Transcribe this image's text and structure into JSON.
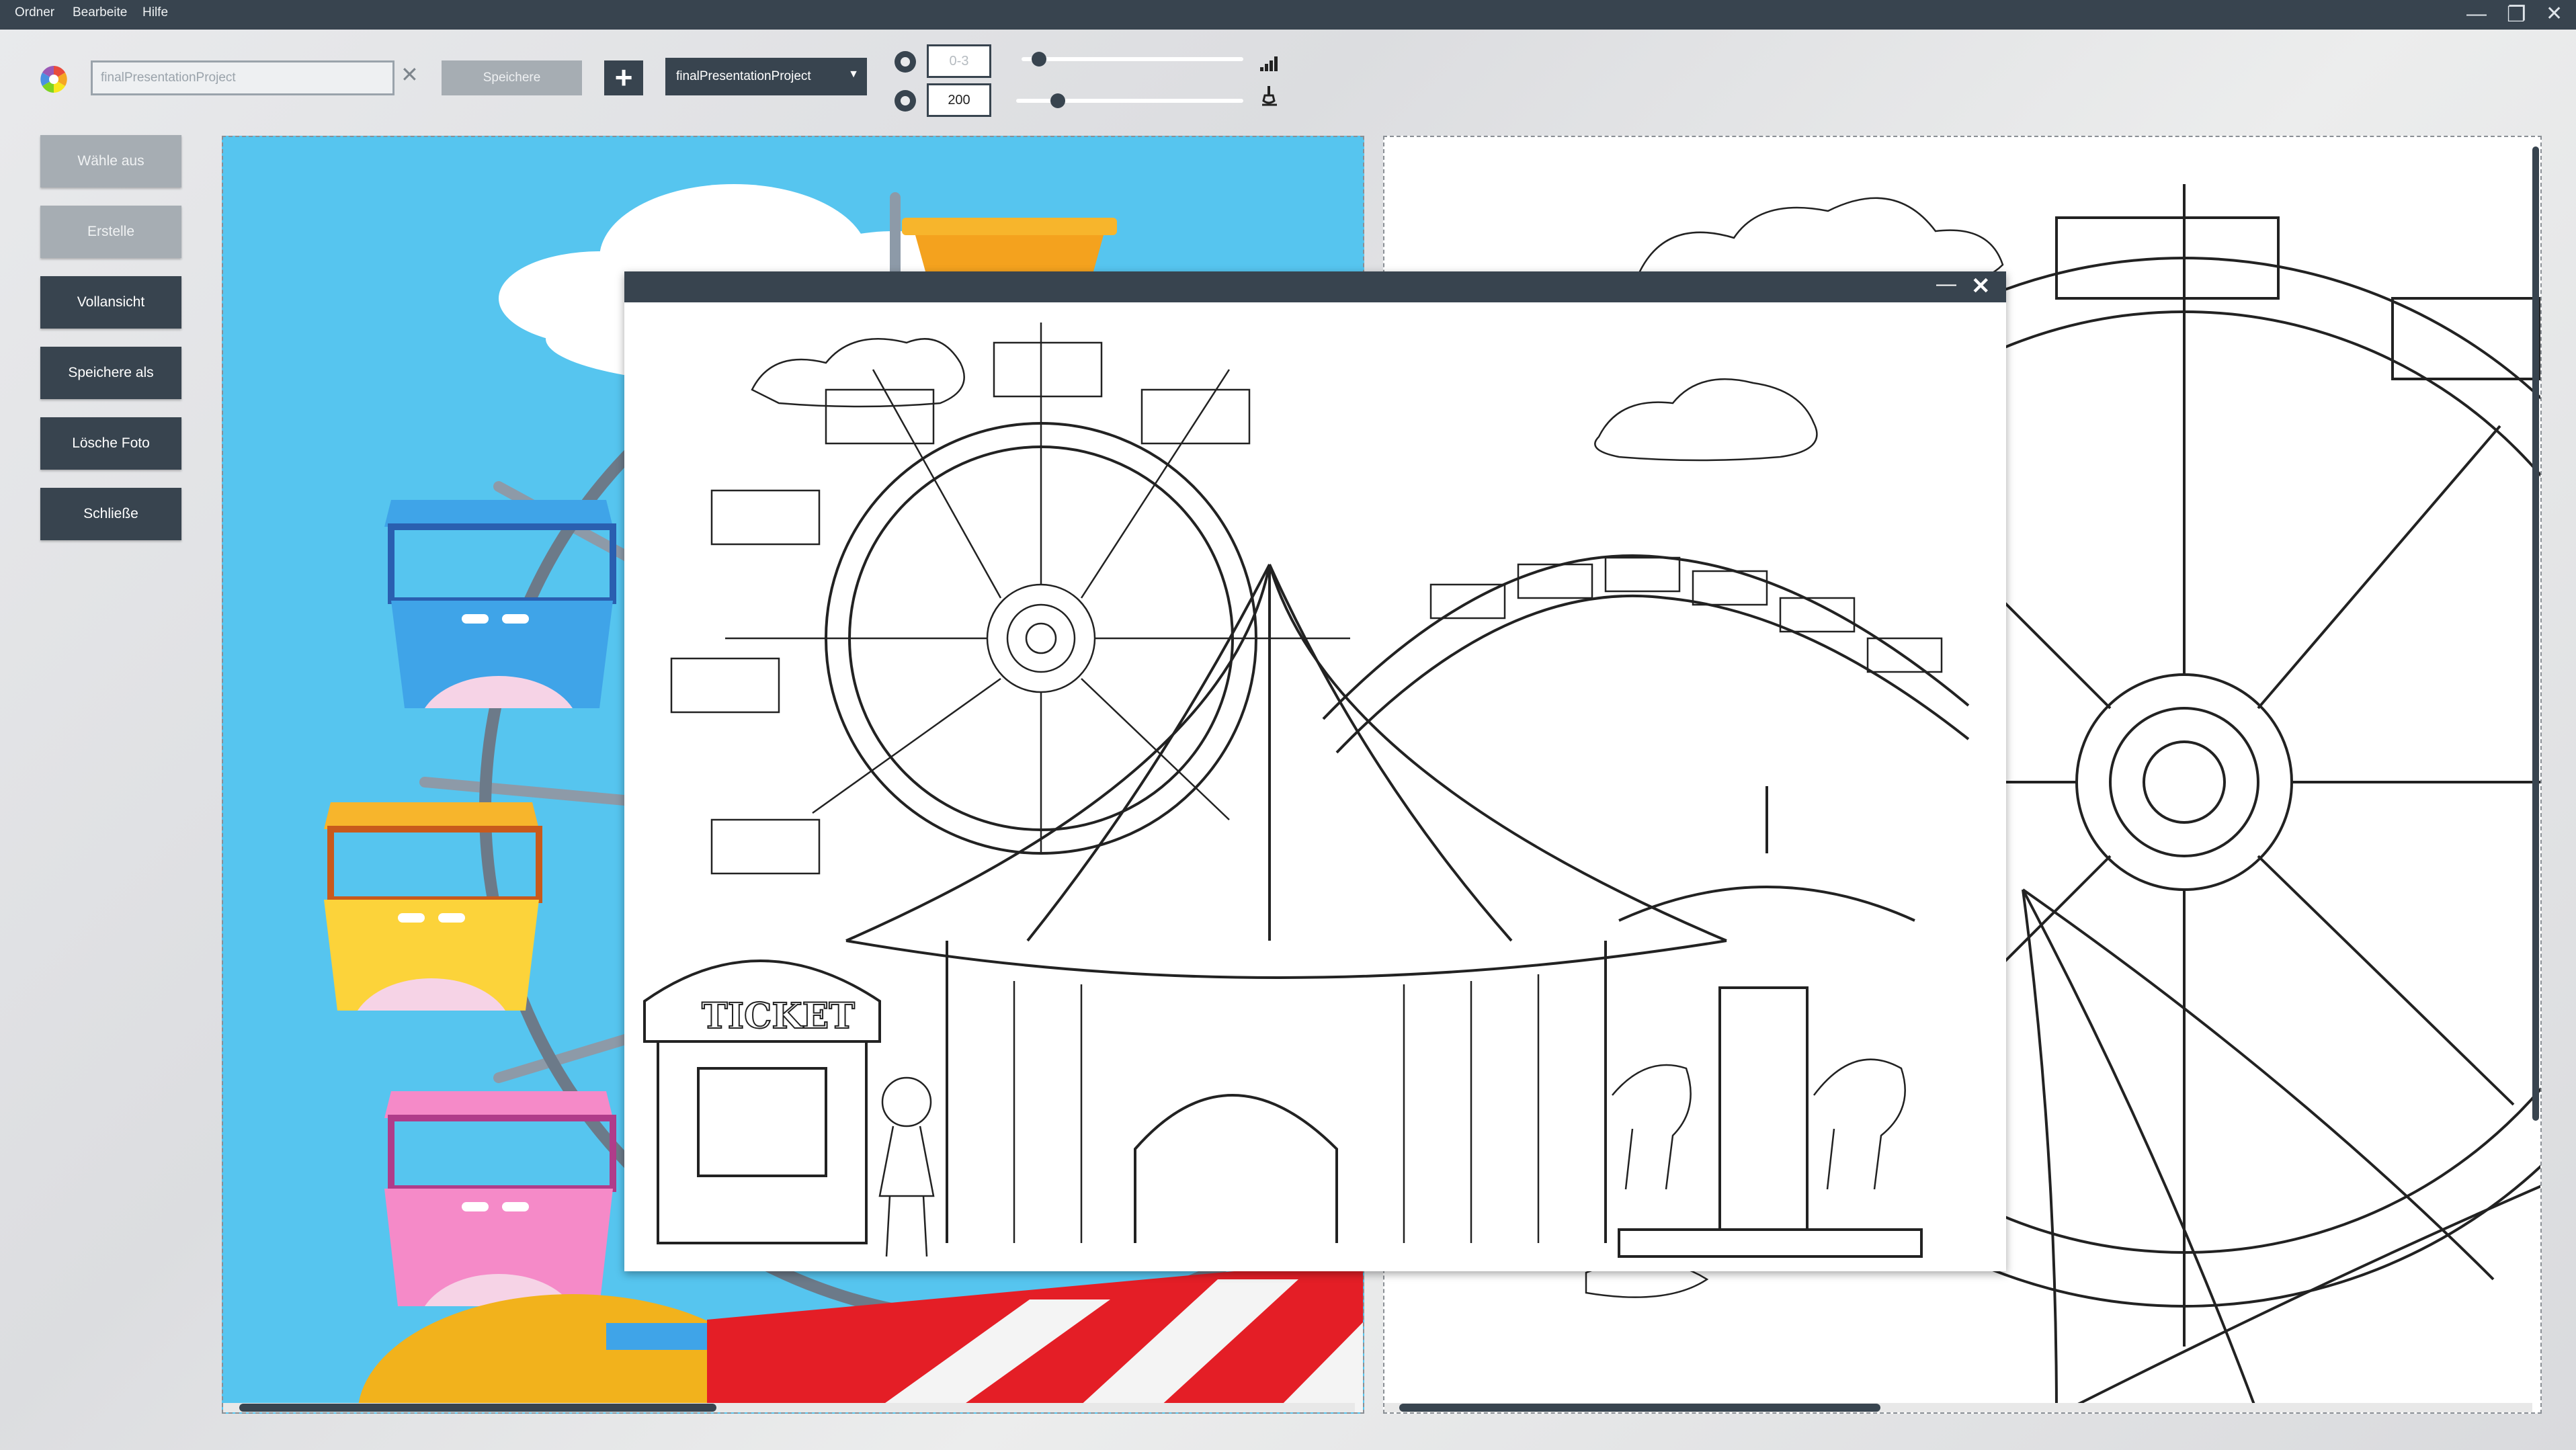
{
  "menu": {
    "items": [
      "Ordner",
      "Bearbeite",
      "Hilfe"
    ]
  },
  "window_controls": {
    "minimize": "—",
    "maximize": "❐",
    "close": "✕"
  },
  "toolbar": {
    "project_input_placeholder": "finalPresentationProject",
    "clear_symbol": "✕",
    "save_label": "Speichere",
    "add_symbol": "+",
    "project_select_value": "finalPresentationProject",
    "range_field_placeholder": "0-3",
    "value_field": "200",
    "slider1_level": 0.05,
    "slider2_level": 0.16
  },
  "sidebar": {
    "items": [
      {
        "label": "Wähle aus"
      },
      {
        "label": "Erstelle"
      },
      {
        "label": "Vollansicht"
      },
      {
        "label": "Speichere als"
      },
      {
        "label": "Lösche Foto"
      },
      {
        "label": "Schließe"
      }
    ]
  },
  "popup": {
    "minimize": "—",
    "close": "✕",
    "ticket_text": "TICKET"
  },
  "colors": {
    "dark": "#38444f",
    "gray_button": "#a6adb3",
    "sky": "#56c5ef"
  }
}
